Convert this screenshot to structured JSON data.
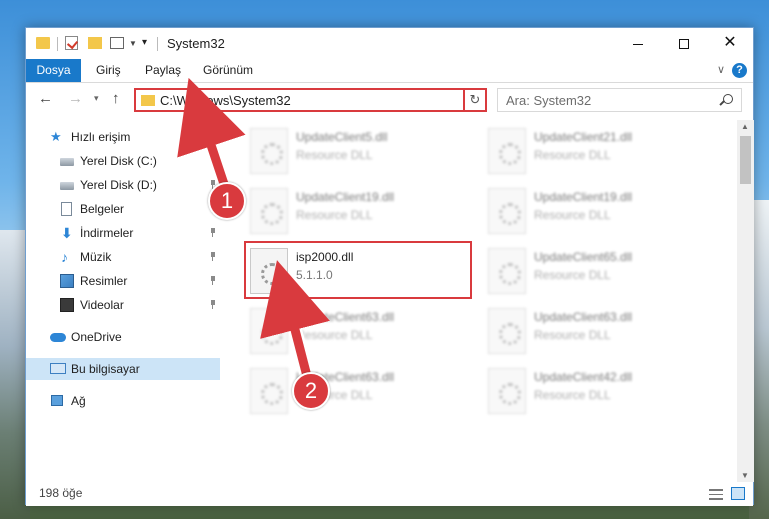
{
  "window": {
    "title": "System32"
  },
  "ribbon": {
    "tabs": [
      {
        "label": "Dosya"
      },
      {
        "label": "Giriş"
      },
      {
        "label": "Paylaş"
      },
      {
        "label": "Görünüm"
      }
    ],
    "accent_color": "#1979ca"
  },
  "address": {
    "path": "C:\\Windows\\System32",
    "highlight_color": "#d93a3e"
  },
  "search": {
    "placeholder": "Ara: System32"
  },
  "sidebar": {
    "items": [
      {
        "label": "Hızlı erişim",
        "icon": "star-icon",
        "pinned": false
      },
      {
        "label": "Yerel Disk (C:)",
        "icon": "drive-icon",
        "pinned": true
      },
      {
        "label": "Yerel Disk (D:)",
        "icon": "drive-icon",
        "pinned": true
      },
      {
        "label": "Belgeler",
        "icon": "document-icon",
        "pinned": true
      },
      {
        "label": "İndirmeler",
        "icon": "download-icon",
        "pinned": true
      },
      {
        "label": "Müzik",
        "icon": "music-icon",
        "pinned": true
      },
      {
        "label": "Resimler",
        "icon": "pictures-icon",
        "pinned": true
      },
      {
        "label": "Videolar",
        "icon": "videos-icon",
        "pinned": true
      },
      {
        "label": "OneDrive",
        "icon": "cloud-icon",
        "pinned": false
      },
      {
        "label": "Bu bilgisayar",
        "icon": "computer-icon",
        "pinned": false,
        "selected": true
      },
      {
        "label": "Ağ",
        "icon": "network-icon",
        "pinned": false
      }
    ]
  },
  "files": [
    {
      "name": "UpdateClient5.dll",
      "desc": "Resource DLL",
      "blurred": true
    },
    {
      "name": "UpdateClient21.dll",
      "desc": "Resource DLL",
      "blurred": true
    },
    {
      "name": "UpdateClient19.dll",
      "desc": "Resource DLL",
      "blurred": true
    },
    {
      "name": "UpdateClient19.dll",
      "desc": "Resource DLL",
      "blurred": true
    },
    {
      "name": "isp2000.dll",
      "desc": "5.1.1.0",
      "blurred": false
    },
    {
      "name": "UpdateClient65.dll",
      "desc": "Resource DLL",
      "blurred": true
    },
    {
      "name": "UpdateClient63.dll",
      "desc": "Resource DLL",
      "blurred": true
    },
    {
      "name": "UpdateClient63.dll",
      "desc": "Resource DLL",
      "blurred": true
    },
    {
      "name": "UpdateClient63.dll",
      "desc": "Resource DLL",
      "blurred": true
    },
    {
      "name": "UpdateClient42.dll",
      "desc": "Resource DLL",
      "blurred": true
    }
  ],
  "status": {
    "count": "198 öğe"
  },
  "annotations": {
    "badge_1": "1",
    "badge_2": "2",
    "color": "#d93a3e"
  }
}
